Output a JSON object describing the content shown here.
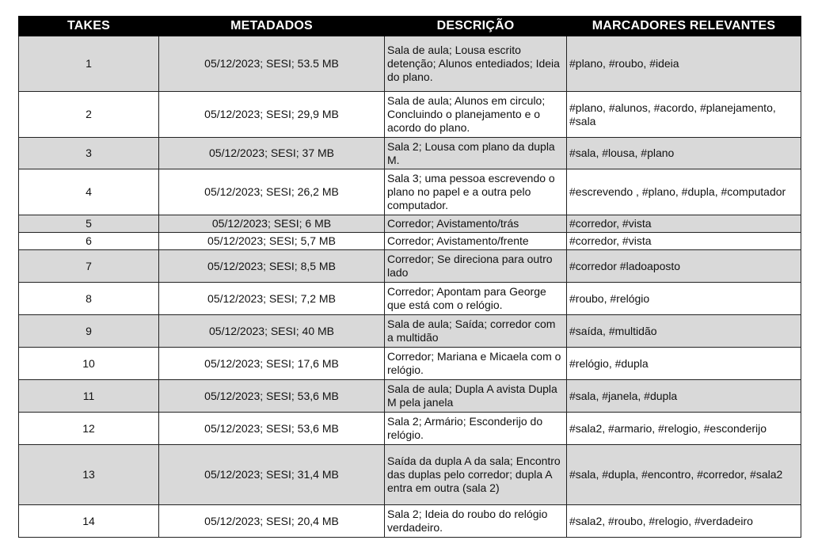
{
  "table": {
    "headers": [
      "TAKES",
      "METADADOS",
      "DESCRIÇÃO",
      "MARCADORES RELEVANTES"
    ],
    "rows": [
      {
        "take": "1",
        "meta": "05/12/2023; SESI; 53.5 MB",
        "desc": "Sala de aula; Lousa escrito detenção; Alunos entediados; Ideia do plano.",
        "tags": "#plano, #roubo, #ideia"
      },
      {
        "take": "2",
        "meta": "05/12/2023; SESI; 29,9 MB",
        "desc": "Sala de aula; Alunos em circulo; Concluindo o planejamento e o acordo do plano.",
        "tags": "#plano, #alunos, #acordo, #planejamento, #sala"
      },
      {
        "take": "3",
        "meta": "05/12/2023; SESI; 37 MB",
        "desc": "Sala 2; Lousa com plano da dupla M.",
        "tags": "#sala, #lousa, #plano"
      },
      {
        "take": "4",
        "meta": "05/12/2023; SESI; 26,2 MB",
        "desc": "Sala 3; uma pessoa escrevendo o plano no papel e a outra pelo computador.",
        "tags": "#escrevendo , #plano, #dupla, #computador"
      },
      {
        "take": "5",
        "meta": "05/12/2023; SESI; 6 MB",
        "desc": "Corredor; Avistamento/trás",
        "tags": "#corredor, #vista"
      },
      {
        "take": "6",
        "meta": "05/12/2023; SESI; 5,7 MB",
        "desc": "Corredor; Avistamento/frente",
        "tags": "#corredor, #vista"
      },
      {
        "take": "7",
        "meta": "05/12/2023; SESI; 8,5 MB",
        "desc": "Corredor; Se direciona para outro lado",
        "tags": "#corredor #ladoaposto"
      },
      {
        "take": "8",
        "meta": "05/12/2023; SESI; 7,2 MB",
        "desc": "Corredor; Apontam para George que está com o relógio.",
        "tags": "#roubo, #relógio"
      },
      {
        "take": "9",
        "meta": "05/12/2023; SESI; 40 MB",
        "desc": "Sala de aula; Saída; corredor com a multidão",
        "tags": "#saída, #multidão"
      },
      {
        "take": "10",
        "meta": "05/12/2023; SESI; 17,6 MB",
        "desc": "Corredor; Mariana e Micaela com o relógio.",
        "tags": "#relógio, #dupla"
      },
      {
        "take": "11",
        "meta": "05/12/2023; SESI; 53,6 MB",
        "desc": "Sala de aula; Dupla A avista Dupla M pela janela",
        "tags": "#sala, #janela, #dupla"
      },
      {
        "take": "12",
        "meta": "05/12/2023; SESI; 53,6 MB",
        "desc": "Sala 2; Armário; Esconderijo do relógio.",
        "tags": "#sala2, #armario, #relogio, #esconderijo"
      },
      {
        "take": "13",
        "meta": "05/12/2023; SESI; 31,4 MB",
        "desc": "Saída da dupla A da sala; Encontro das duplas pelo corredor; dupla A entra em outra (sala 2)",
        "tags": "#sala, #dupla, #encontro, #corredor, #sala2"
      },
      {
        "take": "14",
        "meta": "05/12/2023; SESI; 20,4 MB",
        "desc": "Sala 2; Ideia do roubo do relógio verdadeiro.",
        "tags": "#sala2, #roubo, #relogio, #verdadeiro"
      }
    ]
  }
}
